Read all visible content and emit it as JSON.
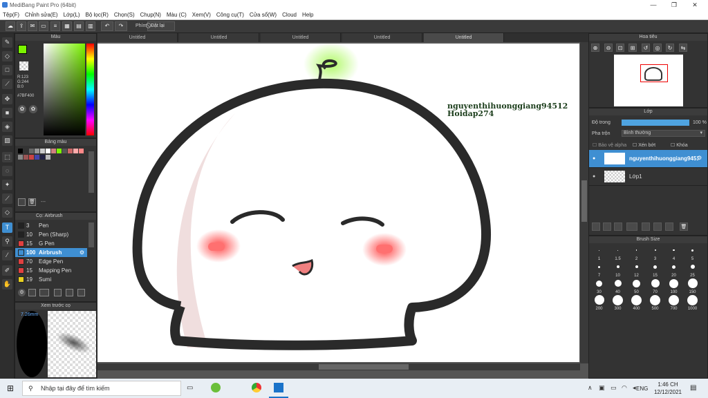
{
  "app": {
    "title": "MediBang Paint Pro (64bit)"
  },
  "menu": [
    "Tệp(F)",
    "Chỉnh sửa(E)",
    "Lớp(L)",
    "Bộ lọc(R)",
    "Chọn(S)",
    "Chụp(N)",
    "Màu (C)",
    "Xem(V)",
    "Công cụ(T)",
    "Cửa sổ(W)",
    "Cloud",
    "Help"
  ],
  "toolbar": {
    "keys_label": "Phím",
    "reset_label": "Đặt lại"
  },
  "tabs": [
    "Untitled",
    "Untitled",
    "Untitled",
    "Untitled",
    "Untitled"
  ],
  "color_panel": {
    "title": "Màu",
    "r": "R:123",
    "g": "G:244",
    "b": "B:0",
    "hex": "#7BF400",
    "fg_color": "#7bf400"
  },
  "palette": {
    "title": "Bảng màu",
    "label": "---",
    "colors": [
      "#000000",
      "#333333",
      "#666666",
      "#999999",
      "#cccccc",
      "#ffffff",
      "#d08080",
      "#7bf400",
      "#555555",
      "#cc6666",
      "#ffaaaa",
      "#ff8888",
      "#888888",
      "#995555",
      "#cc4444",
      "#4444aa",
      "#222244",
      "#bbbbbb"
    ]
  },
  "brush_panel": {
    "title": "Cọ: Airbrush",
    "items": [
      {
        "size": "3",
        "name": "Pen",
        "color": "#222222"
      },
      {
        "size": "10",
        "name": "Pen (Sharp)",
        "color": "#222222"
      },
      {
        "size": "15",
        "name": "G Pen",
        "color": "#e04040"
      },
      {
        "size": "100",
        "name": "Airbrush",
        "color": "#3f8fd2"
      },
      {
        "size": "70",
        "name": "Edge Pen",
        "color": "#e04040"
      },
      {
        "size": "15",
        "name": "Mapping Pen",
        "color": "#e04040"
      },
      {
        "size": "19",
        "name": "Sumi",
        "color": "#e8d020"
      }
    ],
    "selected_index": 3
  },
  "brush_preview": {
    "title": "Xem trước cọ",
    "size_label": "7.26mm"
  },
  "navigator": {
    "title": "Hoa tiêu"
  },
  "layers_panel": {
    "title": "Lớp",
    "opacity_label": "Độ trong",
    "opacity_value": "100 %",
    "opacity": 1.0,
    "blend_label": "Pha trộn",
    "blend_value": "Bình thường",
    "protect_alpha": "Bảo vệ alpha",
    "clipping": "Xén bớt",
    "lock": "Khóa",
    "layers": [
      {
        "name": "nguyenthihuonggiang94512",
        "selected": true
      },
      {
        "name": "Lớp1",
        "selected": false
      }
    ]
  },
  "brush_size": {
    "title": "Brush Size",
    "sizes": [
      "1",
      "1.5",
      "2",
      "3",
      "4",
      "5",
      "7",
      "10",
      "12",
      "15",
      "20",
      "25",
      "30",
      "40",
      "50",
      "70",
      "100",
      "150",
      "200",
      "300",
      "400",
      "500",
      "700",
      "1000"
    ]
  },
  "canvas_text": {
    "line1": "nguyenthihuonggiang94512",
    "line2": "Hoidap274"
  },
  "taskbar": {
    "search_placeholder": "Nhập tại đây để tìm kiếm",
    "lang": "ENG",
    "time": "1:46 CH",
    "date": "12/12/2021"
  }
}
